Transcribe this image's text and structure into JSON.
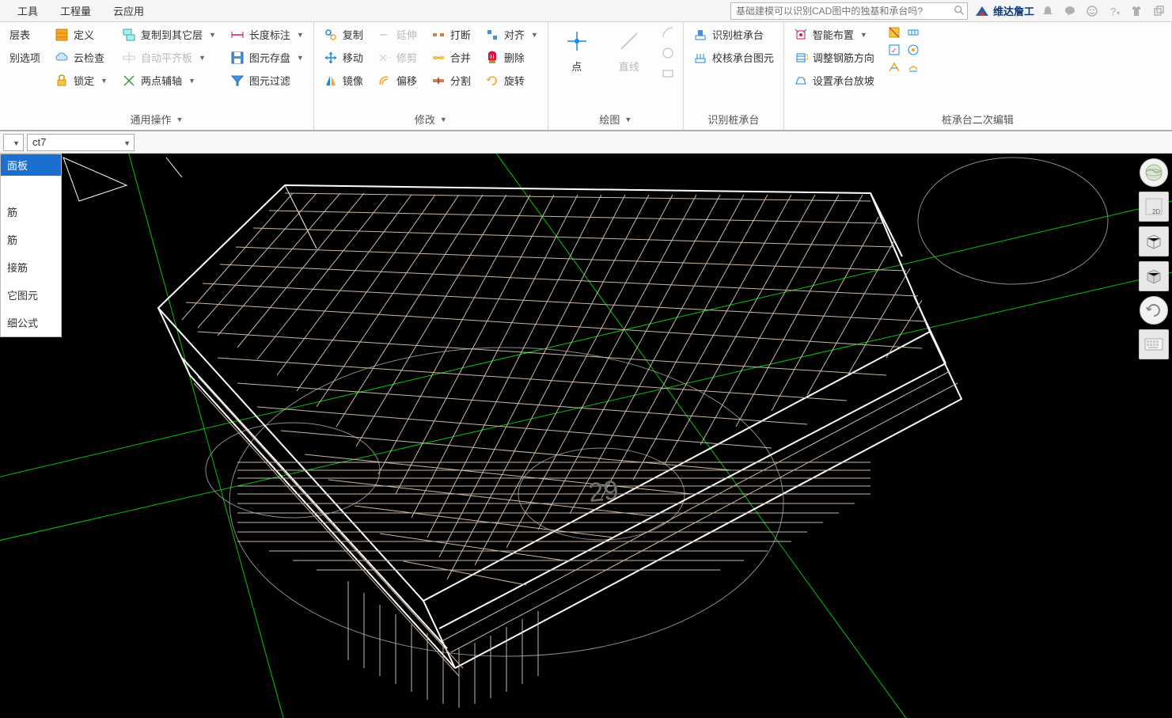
{
  "menubar": {
    "items": [
      "工具",
      "工程量",
      "云应用"
    ],
    "search_placeholder": "基础建模可以识别CAD图中的独基和承台吗?",
    "user_label": "维达詹工"
  },
  "ribbon": {
    "group1": {
      "col1": [
        "层表",
        "别选项"
      ],
      "col2": [
        {
          "icon": "orange-grid",
          "label": "定义",
          "dd": false
        },
        {
          "icon": "cloud",
          "label": "云检查",
          "dd": false
        },
        {
          "icon": "lock",
          "label": "锁定",
          "dd": true
        }
      ],
      "col3": [
        {
          "icon": "copy-layer",
          "label": "复制到其它层",
          "dd": true,
          "disabled": false
        },
        {
          "icon": "align-h",
          "label": "自动平齐板",
          "dd": true,
          "disabled": true
        },
        {
          "icon": "axes",
          "label": "两点辅轴",
          "dd": true,
          "disabled": false
        }
      ],
      "col4": [
        {
          "icon": "dimension",
          "label": "长度标注",
          "dd": true
        },
        {
          "icon": "save-cad",
          "label": "图元存盘",
          "dd": true
        },
        {
          "icon": "filter",
          "label": "图元过滤"
        }
      ],
      "label": "通用操作"
    },
    "group2": {
      "col1": [
        {
          "icon": "copy-blue",
          "label": "复制"
        },
        {
          "icon": "move",
          "label": "移动"
        },
        {
          "icon": "mirror",
          "label": "镜像"
        }
      ],
      "col2": [
        {
          "icon": "extend",
          "label": "延伸",
          "disabled": true
        },
        {
          "icon": "trim",
          "label": "修剪",
          "disabled": true
        },
        {
          "icon": "offset",
          "label": "偏移"
        }
      ],
      "col3": [
        {
          "icon": "break",
          "label": "打断"
        },
        {
          "icon": "merge",
          "label": "合并"
        },
        {
          "icon": "split",
          "label": "分割"
        }
      ],
      "col4": [
        {
          "icon": "align",
          "label": "对齐",
          "dd": true
        },
        {
          "icon": "delete",
          "label": "删除"
        },
        {
          "icon": "rotate",
          "label": "旋转"
        }
      ],
      "label": "修改"
    },
    "group3": {
      "big": [
        {
          "icon": "point",
          "label": "点",
          "disabled": false
        },
        {
          "icon": "line",
          "label": "直线",
          "disabled": true
        }
      ],
      "smallcol": [
        {
          "icon": "arc",
          "label": ""
        },
        {
          "icon": "circle",
          "label": ""
        },
        {
          "icon": "rect",
          "label": ""
        }
      ],
      "label": "绘图"
    },
    "group4": {
      "col1": [
        {
          "icon": "recognize",
          "label": "识别桩承台"
        },
        {
          "icon": "check-cad",
          "label": "校核承台图元"
        }
      ],
      "label": "识别桩承台"
    },
    "group5": {
      "col1": [
        {
          "icon": "smart",
          "label": "智能布置",
          "dd": true
        },
        {
          "icon": "rotate-rebar",
          "label": "调整钢筋方向"
        },
        {
          "icon": "slope",
          "label": "设置承台放坡"
        }
      ],
      "smallcol": [
        {
          "icon": "sa"
        },
        {
          "icon": "sb"
        },
        {
          "icon": "sc"
        },
        {
          "icon": "sd"
        },
        {
          "icon": "se"
        },
        {
          "icon": "sf"
        }
      ],
      "label": "桩承台二次编辑"
    }
  },
  "selector": {
    "combo1": "",
    "combo2": "ct7"
  },
  "sidePanel": {
    "title": "面板",
    "items": [
      "筋",
      "筋",
      "接筋",
      "它图元",
      "细公式"
    ]
  },
  "rightTools": {
    "labels": [
      "globe",
      "2D",
      "cube-wire",
      "cube-solid",
      "rotate",
      "⌨"
    ]
  },
  "canvas": {
    "label_29": "29"
  }
}
